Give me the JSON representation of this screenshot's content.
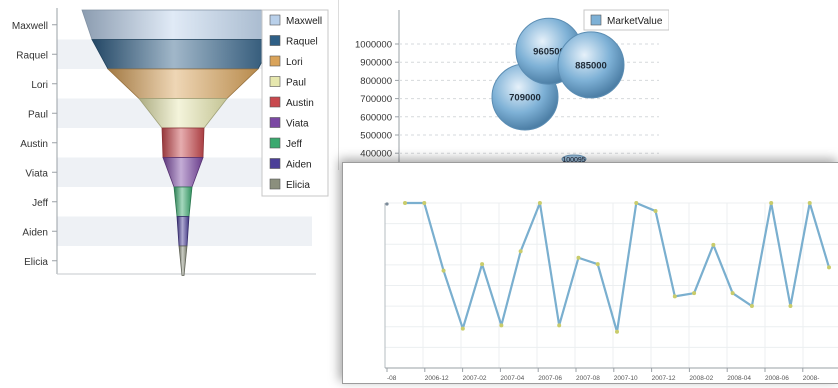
{
  "funnel": {
    "chart_data": {
      "type": "funnel",
      "categories": [
        "Maxwell",
        "Raquel",
        "Lori",
        "Paul",
        "Austin",
        "Viata",
        "Jeff",
        "Aiden",
        "Elicia"
      ],
      "legend": [
        "Maxwell",
        "Raquel",
        "Lori",
        "Paul",
        "Austin",
        "Viata",
        "Jeff",
        "Aiden",
        "Elicia"
      ],
      "legend_position": "top-right",
      "colors": [
        "#b9d0ea",
        "#2f5f86",
        "#d9a35a",
        "#e6e7ae",
        "#c8494e",
        "#7b48a3",
        "#3aa96f",
        "#4b3f98",
        "#8b8f7d"
      ]
    }
  },
  "bubble": {
    "chart_data": {
      "type": "scatter",
      "series": [
        {
          "name": "MarketValue",
          "values": [
            709000,
            960500,
            885000
          ]
        }
      ],
      "x": [
        1,
        2,
        3
      ],
      "y_ticks": [
        400000,
        500000,
        600000,
        700000,
        800000,
        900000,
        1000000
      ],
      "point_labels": [
        "709000",
        "960500",
        "885000"
      ],
      "legend_position": "top-right",
      "color": "#7eb1d6"
    },
    "partial_label": "100095"
  },
  "line": {
    "chart_data": {
      "type": "line",
      "values": [
        100,
        100,
        58,
        22,
        62,
        24,
        70,
        100,
        24,
        66,
        62,
        20,
        100,
        95,
        42,
        44,
        74,
        44,
        36,
        100,
        36,
        100,
        60
      ],
      "x_tick_labels": [
        "-08",
        "2006-12",
        "2007-02",
        "2007-04",
        "2007-06",
        "2007-08",
        "2007-10",
        "2007-12",
        "2008-02",
        "2008-04",
        "2008-06",
        "2008-"
      ],
      "grid": true,
      "color": "#7aafcf",
      "marker_color": "#c9cc6b"
    }
  }
}
